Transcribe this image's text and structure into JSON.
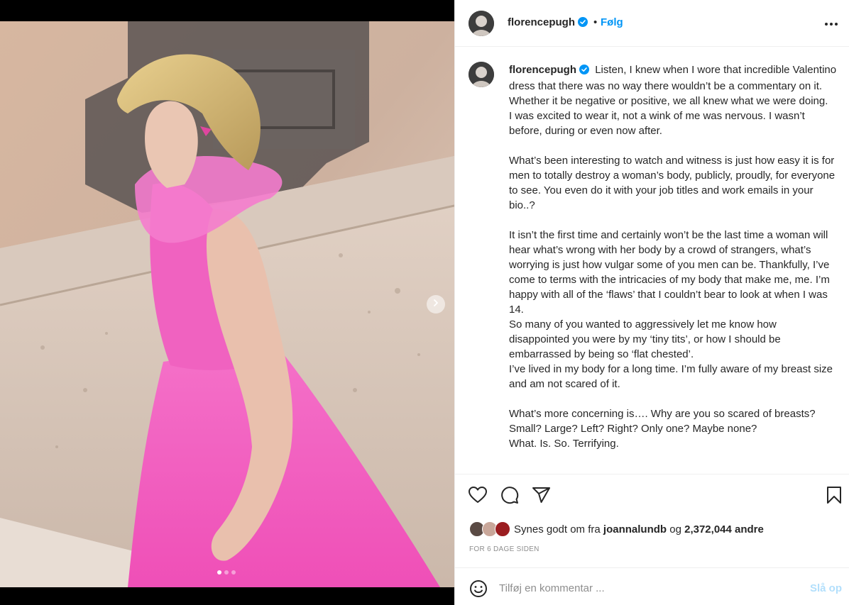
{
  "post": {
    "username": "florencepugh",
    "verified": true,
    "follow_separator": "•",
    "follow_label": "Følg",
    "more_icon": "more-horizontal-icon"
  },
  "caption": {
    "username": "florencepugh",
    "paragraphs": [
      "Listen, I knew when I wore that incredible Valentino dress that there was no way there wouldn’t be a commentary on it. Whether it be negative or positive, we all knew what we were doing.",
      "I was excited to wear it, not a wink of me was nervous. I wasn’t before, during or even now after.",
      "",
      "What’s been interesting to watch and witness is just how easy it is for men to totally destroy a woman’s body, publicly, proudly, for everyone to see. You even do it with your job titles and work emails in your bio..?",
      "",
      "It isn’t the first time and certainly won’t be the last time a woman will hear what’s wrong with her body by a crowd of strangers, what’s worrying is just how vulgar some of you men can be. Thankfully, I’ve come to terms with the intricacies of my body that make me, me. I’m happy with all of the ‘flaws’ that I couldn’t bear to look at when I was 14.",
      "So many of you wanted to aggressively let me know how disappointed you were by my ‘tiny tits’, or how I should be embarrassed by being so ‘flat chested’.",
      "I’ve lived in my body for a long time. I’m fully aware of my breast size and am not scared of it.",
      "",
      "What’s more concerning is…. Why are you so scared of breasts? Small? Large? Left? Right? Only one? Maybe none?",
      "What. Is. So. Terrifying."
    ]
  },
  "media": {
    "carousel_count": 3,
    "carousel_active_index": 0,
    "next_icon": "chevron-right-icon"
  },
  "actions": {
    "like_icon": "heart-icon",
    "comment_icon": "comment-icon",
    "share_icon": "send-icon",
    "save_icon": "bookmark-icon"
  },
  "likes": {
    "prefix": "Synes godt om fra",
    "first_user": "joannalundb",
    "connector": "og",
    "others_count": "2,372,044 andre"
  },
  "timestamp": "For 6 dage siden",
  "comment_box": {
    "emoji_icon": "smiley-icon",
    "placeholder": "Tilføj en kommentar ...",
    "post_label": "Slå op"
  },
  "colors": {
    "accent": "#0095f6",
    "accent_disabled": "#b2dffc",
    "text": "#262626",
    "muted": "#8e8e8e",
    "dress": "#f25bc2"
  }
}
